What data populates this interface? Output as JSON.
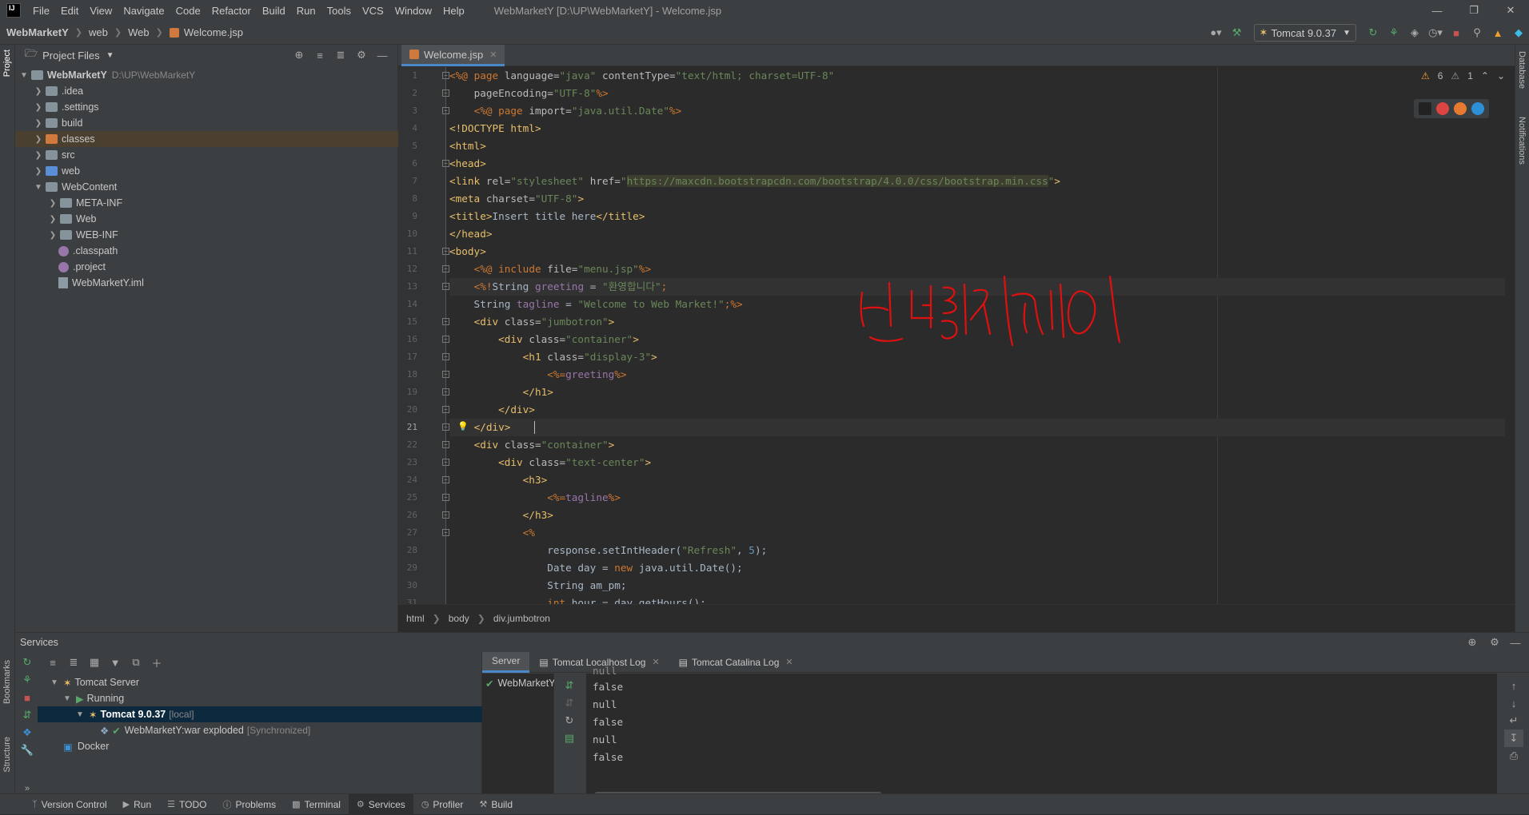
{
  "menu": {
    "items": [
      "File",
      "Edit",
      "View",
      "Navigate",
      "Code",
      "Refactor",
      "Build",
      "Run",
      "Tools",
      "VCS",
      "Window",
      "Help"
    ],
    "window_title": "WebMarketY [D:\\UP\\WebMarketY] - Welcome.jsp"
  },
  "nav": {
    "breadcrumbs": [
      "WebMarketY",
      "web",
      "Web",
      "Welcome.jsp"
    ],
    "run_config": "Tomcat 9.0.37"
  },
  "project": {
    "header": "Project Files",
    "root": "WebMarketY",
    "root_path": "D:\\UP\\WebMarketY",
    "items": [
      {
        "label": ".idea",
        "kind": "folder"
      },
      {
        "label": ".settings",
        "kind": "folder"
      },
      {
        "label": "build",
        "kind": "folder"
      },
      {
        "label": "classes",
        "kind": "folder-orange"
      },
      {
        "label": "src",
        "kind": "folder"
      },
      {
        "label": "web",
        "kind": "folder-blue"
      },
      {
        "label": "WebContent",
        "kind": "folder"
      },
      {
        "label": "META-INF",
        "kind": "folder"
      },
      {
        "label": "Web",
        "kind": "folder"
      },
      {
        "label": "WEB-INF",
        "kind": "folder"
      },
      {
        "label": ".classpath",
        "kind": "file"
      },
      {
        "label": ".project",
        "kind": "file"
      },
      {
        "label": "WebMarketY.iml",
        "kind": "xml"
      }
    ],
    "stripe_label": "Project"
  },
  "editor": {
    "tab": "Welcome.jsp",
    "inspections": {
      "warnings": "6",
      "weak": "1"
    },
    "breadcrumb": [
      "html",
      "body",
      "div.jumbotron"
    ],
    "handwriting": "빈젤리제이"
  },
  "right_stripe": [
    "Database",
    "Notifications"
  ],
  "left_stripe_bottom": [
    "Bookmarks",
    "Structure"
  ],
  "services": {
    "title": "Services",
    "tree": {
      "server": "Tomcat Server",
      "running": "Running",
      "tomcat": "Tomcat 9.0.37",
      "tomcat_suffix": "[local]",
      "artifact": "WebMarketY:war exploded",
      "artifact_suffix": "[Synchronized]",
      "docker": "Docker"
    },
    "tabs": [
      "Server",
      "Tomcat Localhost Log",
      "Tomcat Catalina Log"
    ],
    "deploy_item": "WebMarketY:",
    "console": [
      "null",
      "false",
      "null",
      "false",
      "null",
      "false"
    ]
  },
  "bottom_tabs": [
    "Version Control",
    "Run",
    "TODO",
    "Problems",
    "Terminal",
    "Services",
    "Profiler",
    "Build"
  ]
}
